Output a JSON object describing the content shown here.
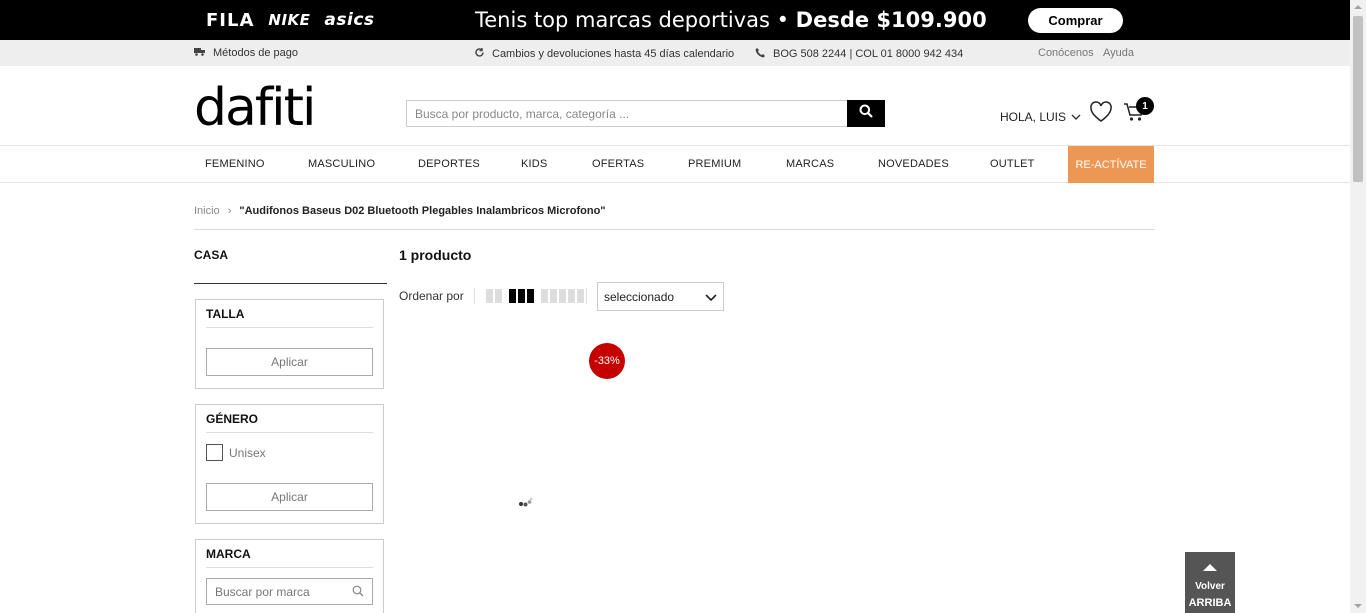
{
  "promo": {
    "brands": [
      "FILA",
      "NIKE",
      "asics"
    ],
    "headline_text": "Tenis top marcas deportivas • ",
    "headline_price": "Desde $109.900",
    "buy_label": "Comprar"
  },
  "utility": {
    "payment": "Métodos de pago",
    "returns": "Cambios y devoluciones hasta 45 días calendario",
    "phone": "BOG 508 2244 | COL 01 8000 942 434",
    "about": "Conócenos",
    "help": "Ayuda"
  },
  "header": {
    "logo": "dafiti",
    "search_placeholder": "Busca por producto, marca, categoría ...",
    "greeting": "HOLA, LUIS",
    "cart_count": "1"
  },
  "nav": {
    "items": [
      "FEMENINO",
      "MASCULINO",
      "DEPORTES",
      "KIDS",
      "OFERTAS",
      "PREMIUM",
      "MARCAS",
      "NOVEDADES",
      "OUTLET"
    ],
    "highlight": "RE-ACTÍVATE",
    "highlight_color": "#ec9854"
  },
  "breadcrumb": {
    "home": "Inicio",
    "separator": "›",
    "current": "\"Audifonos Baseus D02 Bluetooth Plegables Inalambricos Microfono\""
  },
  "sidebar": {
    "category": "CASA",
    "filters": [
      {
        "title": "TALLA",
        "apply_label": "Aplicar"
      },
      {
        "title": "GÉNERO",
        "option": "Unisex",
        "apply_label": "Aplicar"
      },
      {
        "title": "MARCA",
        "search_placeholder": "Buscar por marca"
      }
    ]
  },
  "results": {
    "count": "1 producto",
    "sort_label": "Ordenar por",
    "sort_value": "seleccionado",
    "discount_badge": "-33%",
    "discount_color": "#c40000"
  },
  "back_to_top": {
    "line1": "Volver",
    "line2": "ARRIBA"
  }
}
